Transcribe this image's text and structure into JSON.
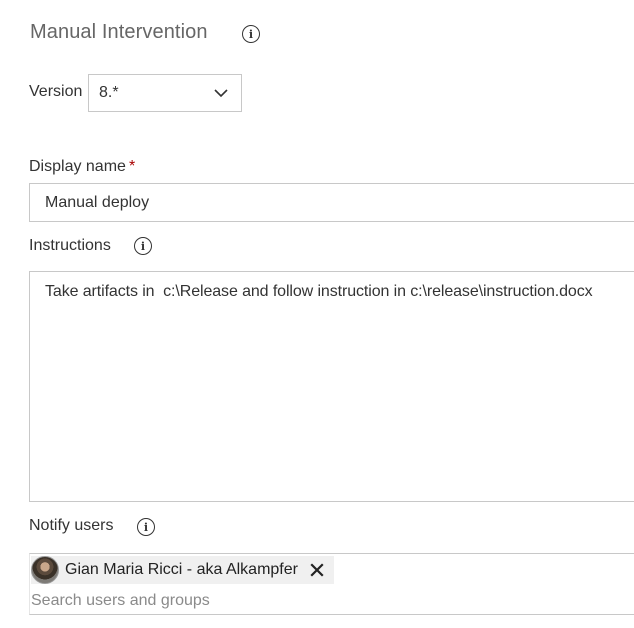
{
  "panel": {
    "title": "Manual Intervention"
  },
  "version": {
    "label": "Version",
    "selected": "8.*"
  },
  "display_name": {
    "label": "Display name",
    "required_marker": "*",
    "value": "Manual deploy"
  },
  "instructions": {
    "label": "Instructions",
    "value": "Take artifacts in  c:\\Release and follow instruction in c:\\release\\instruction.docx"
  },
  "notify_users": {
    "label": "Notify users",
    "selected_users": [
      {
        "name": "Gian Maria Ricci - aka Alkampfer"
      }
    ],
    "search_placeholder": "Search users and groups"
  },
  "icons": {
    "info": "info-icon",
    "dropdown": "chevron-down-icon",
    "remove": "close-icon",
    "avatar": "user-avatar"
  }
}
